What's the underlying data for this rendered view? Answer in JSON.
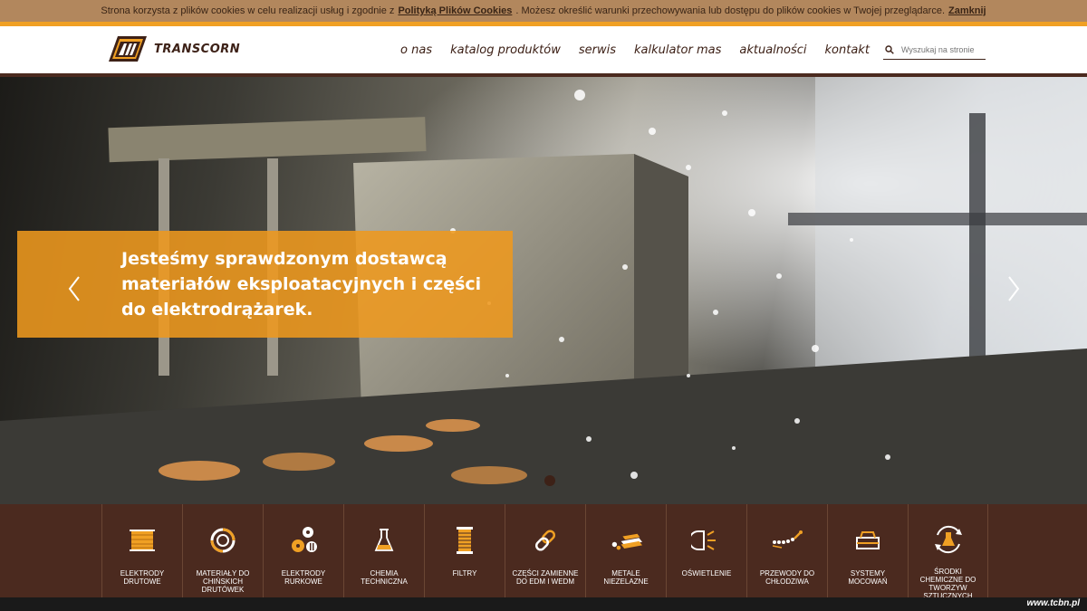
{
  "cookie": {
    "text_before": "Strona korzysta z plików cookies w celu realizacji usług i zgodnie z",
    "policy_link": "Polityką Plików Cookies",
    "text_after": ". Możesz określić warunki przechowywania lub dostępu do plików cookies w Twojej przeglądarce.",
    "close_link": "Zamknij"
  },
  "brand": {
    "name": "TRANSCORN"
  },
  "nav": [
    "o nas",
    "katalog produktów",
    "serwis",
    "kalkulator mas",
    "aktualności",
    "kontakt"
  ],
  "search": {
    "placeholder": "Wyszukaj na stronie"
  },
  "hero": {
    "title": "Jesteśmy sprawdzonym dostawcą materiałów eksploatacyjnych i części do elektrodrążarek."
  },
  "categories": [
    {
      "label": "ELEKTRODY DRUTOWE",
      "icon": "wire-spool-icon"
    },
    {
      "label": "MATERIAŁY DO CHIŃSKICH DRUTÓWEK",
      "icon": "lifebuoy-icon"
    },
    {
      "label": "ELEKTRODY RURKOWE",
      "icon": "tube-electrode-icon"
    },
    {
      "label": "CHEMIA TECHNICZNA",
      "icon": "flask-icon"
    },
    {
      "label": "FILTRY",
      "icon": "filter-icon"
    },
    {
      "label": "CZĘŚCI ZAMIENNE DO EDM I WEDM",
      "icon": "chain-link-icon"
    },
    {
      "label": "METALE NIEZELAZNE",
      "icon": "metal-sheets-icon"
    },
    {
      "label": "OŚWIETLENIE",
      "icon": "lamp-icon"
    },
    {
      "label": "PRZEWODY DO CHŁODZIWA",
      "icon": "coolant-hose-icon"
    },
    {
      "label": "SYSTEMY MOCOWAŃ",
      "icon": "clamp-icon"
    },
    {
      "label": "ŚRODKI CHEMICZNE DO TWORZYW SZTUCZNYCH",
      "icon": "chemical-cycle-icon"
    }
  ],
  "watermark": "www.tcbn.pl",
  "colors": {
    "brown": "#4b2a1f",
    "orange": "#f0a024",
    "cookie_bg": "#b2875d"
  }
}
